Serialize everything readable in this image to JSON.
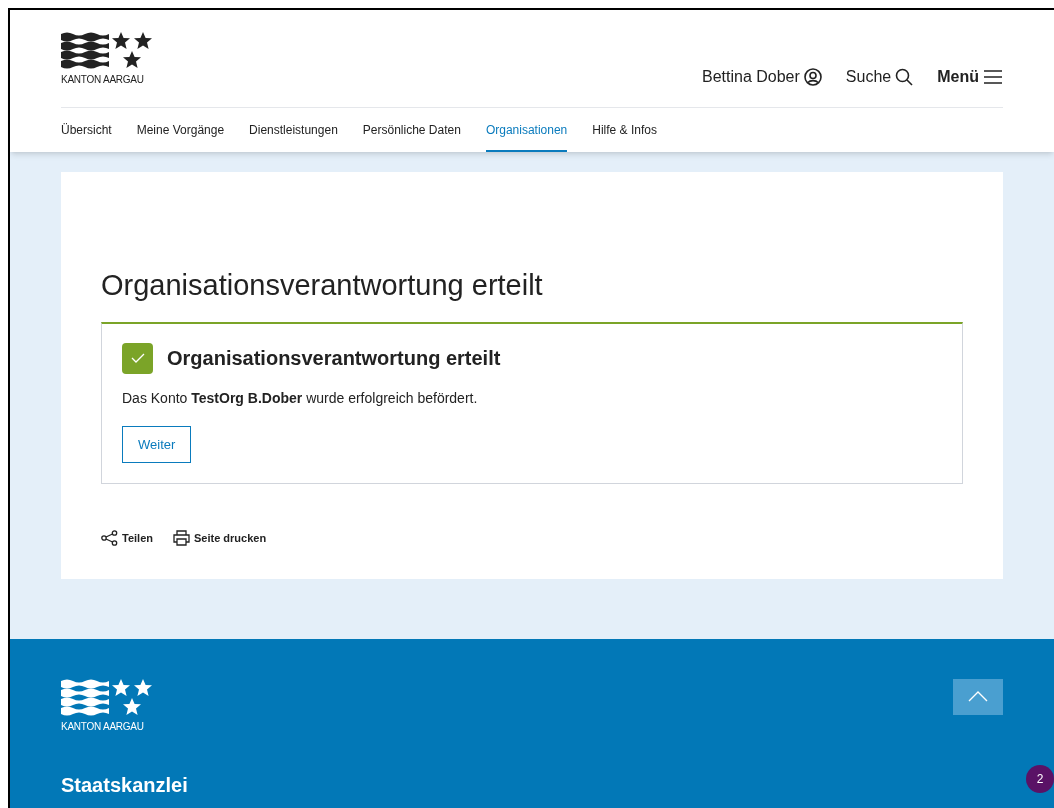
{
  "header": {
    "logo_text": "KANTON AARGAU",
    "user": "Bettina Dober",
    "search": "Suche",
    "menu": "Menü"
  },
  "nav": [
    {
      "label": "Übersicht",
      "selected": false
    },
    {
      "label": "Meine Vorgänge",
      "selected": false
    },
    {
      "label": "Dienstleistungen",
      "selected": false
    },
    {
      "label": "Persönliche Daten",
      "selected": false
    },
    {
      "label": "Organisationen",
      "selected": true
    },
    {
      "label": "Hilfe & Infos",
      "selected": false
    }
  ],
  "page_title": "Organisationsverantwortung erteilt",
  "message": {
    "kind": "success",
    "title": "Organisationsverantwortung erteilt",
    "text": "Das Konto **TestOrg B.Dober** wurde erfolgreich befördert.",
    "button": "Weiter"
  },
  "actions": [
    {
      "kind": "share",
      "label": "Teilen"
    },
    {
      "kind": "print",
      "label": "Seite drucken"
    }
  ],
  "footer": {
    "logo_text": "KANTON AARGAU",
    "title": "Staatskanzlei",
    "badge": "2"
  }
}
